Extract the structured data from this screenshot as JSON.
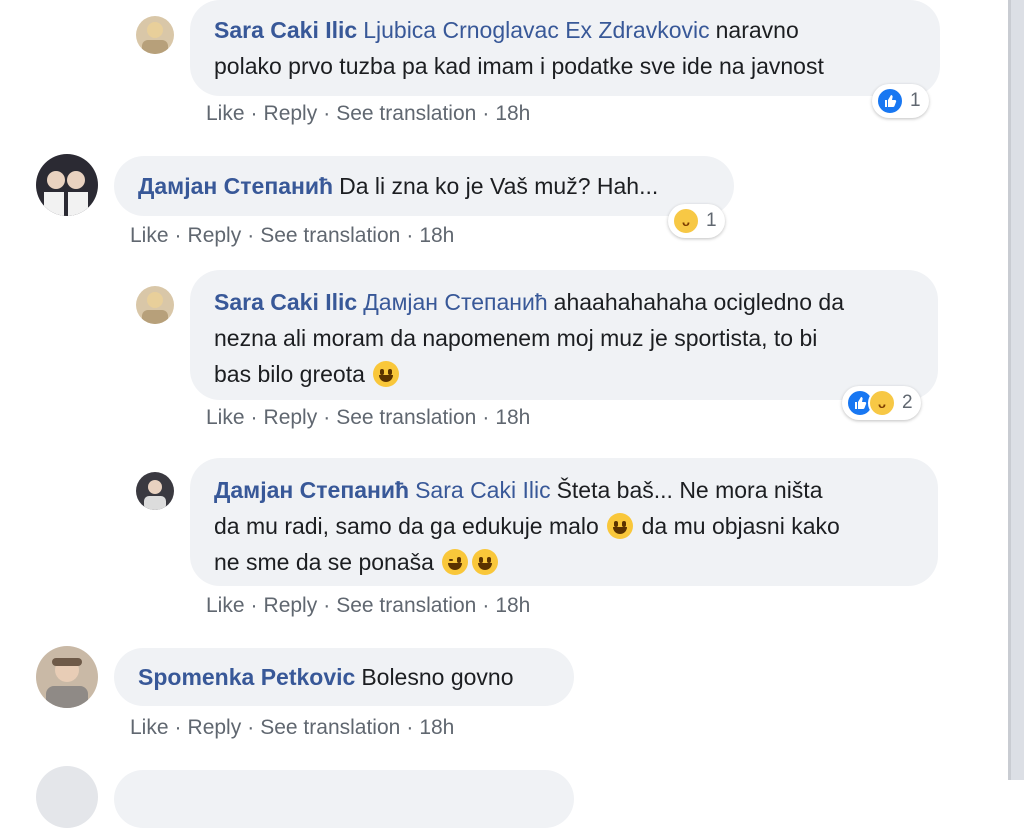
{
  "actions": {
    "like": "Like",
    "reply": "Reply",
    "see_translation": "See translation",
    "separator": "·"
  },
  "comments": [
    {
      "author": "Sara Caki Ilic",
      "mention": "Ljubica Crnoglavac Ex Zdravkovic",
      "line1": "naravno",
      "line2": "polako prvo tuzba pa kad imam i podatke sve ide na javnost",
      "time": "18h",
      "reaction_count": "1",
      "reaction_icons": [
        "like-icon"
      ]
    },
    {
      "author": "Дамјан Степанић",
      "text": "Da li zna ko je Vaš muž? Hah...",
      "time": "18h",
      "reaction_count": "1",
      "reaction_icons": [
        "haha-icon"
      ]
    },
    {
      "author": "Sara Caki Ilic",
      "mention": "Дамјан Степанић",
      "line1": "ahaahahahaha ocigledno da",
      "line2": "nezna ali moram da napomenem moj muz je sportista, to bi",
      "line3": "bas bilo greota",
      "time": "18h",
      "reaction_count": "2",
      "reaction_icons": [
        "like-icon",
        "haha-icon"
      ]
    },
    {
      "author": "Дамјан Степанић",
      "mention": "Sara Caki Ilic",
      "line1": "Šteta baš... Ne mora ništa",
      "line2a": "da mu radi, samo da ga edukuje malo",
      "line2b": "da mu objasni kako",
      "line3": "ne sme da se ponaša",
      "time": "18h"
    },
    {
      "author": "Spomenka Petkovic",
      "text": "Bolesno govno",
      "time": "18h"
    }
  ],
  "colors": {
    "author": "#385898",
    "bubble": "#f0f2f5",
    "meta": "#606770",
    "like_blue": "#1877f2",
    "haha_yellow": "#f7c845"
  }
}
